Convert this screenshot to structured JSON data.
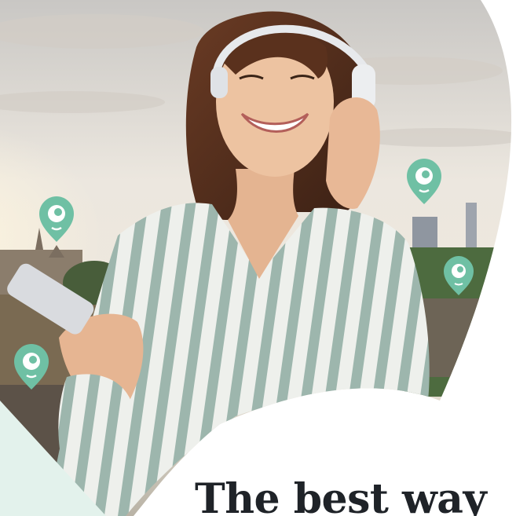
{
  "headline": "The best way",
  "colors": {
    "pin": "#6fc0a4",
    "mint_panel": "#e3f2ec",
    "headline_text": "#1f2328",
    "sky": "#e9e4de"
  },
  "icons": [
    "location-pin-icon"
  ],
  "photo": {
    "subject": "woman-with-headphones-and-phone",
    "location_pin_count": 4
  }
}
